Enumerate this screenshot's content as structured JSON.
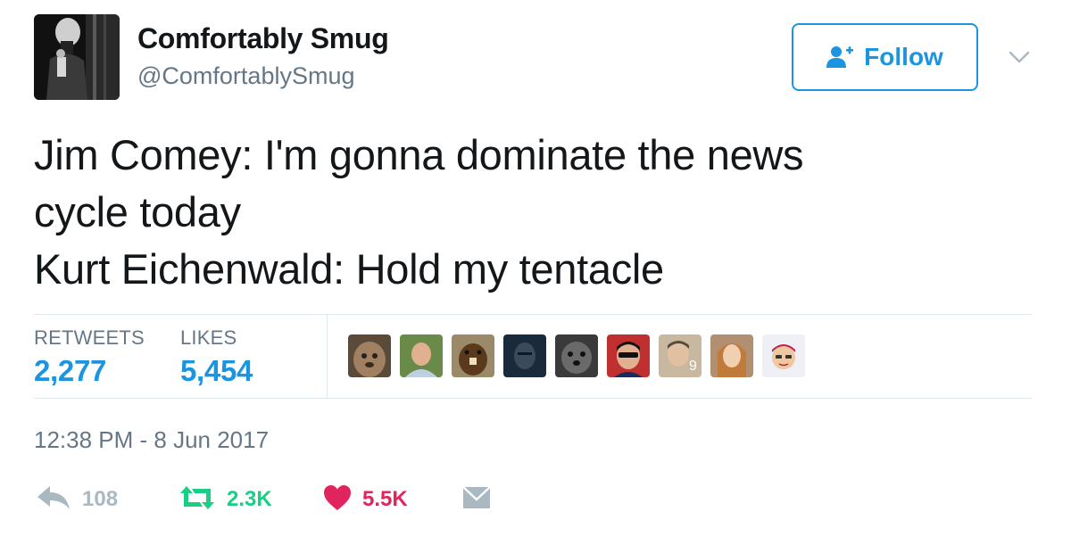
{
  "user": {
    "name": "Comfortably Smug",
    "handle": "@ComfortablySmug",
    "avatar_icon": "profile-photo"
  },
  "follow_button": {
    "label": "Follow",
    "icon": "add-user-icon",
    "color": "#1b95e0"
  },
  "tweet": {
    "lines": [
      "Jim Comey: I'm gonna dominate the news",
      "cycle today",
      "Kurt Eichenwald: Hold my tentacle"
    ]
  },
  "stats": {
    "retweets_label": "RETWEETS",
    "retweets_count": "2,277",
    "likes_label": "LIKES",
    "likes_count": "5,454"
  },
  "likers": [
    {
      "name": "liker-avatar-1",
      "color": "#8a6a4a"
    },
    {
      "name": "liker-avatar-2",
      "color": "#6a8a4a"
    },
    {
      "name": "liker-avatar-3",
      "color": "#7a5a3a"
    },
    {
      "name": "liker-avatar-4",
      "color": "#2a3a4a"
    },
    {
      "name": "liker-avatar-5",
      "color": "#4a4a4a"
    },
    {
      "name": "liker-avatar-6",
      "color": "#1a2a5a"
    },
    {
      "name": "liker-avatar-7",
      "color": "#b8a890"
    },
    {
      "name": "liker-avatar-8",
      "color": "#9a7a5a"
    },
    {
      "name": "liker-avatar-9",
      "color": "#e8e8f0"
    }
  ],
  "timestamp": "12:38 PM - 8 Jun 2017",
  "actions": {
    "reply_count": "108",
    "retweet_count": "2.3K",
    "like_count": "5.5K",
    "reply_color": "#aab8c2",
    "retweet_color": "#19cf86",
    "like_color": "#e0245e"
  }
}
